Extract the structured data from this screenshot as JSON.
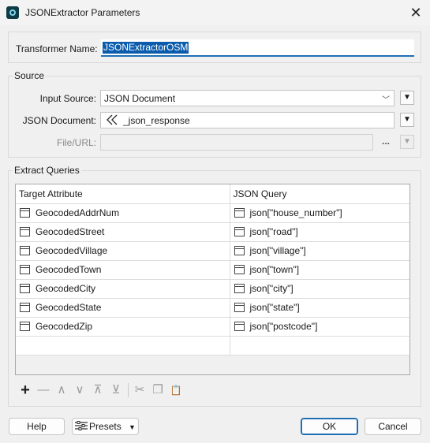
{
  "window": {
    "title": "JSONExtractor Parameters"
  },
  "transformer": {
    "label": "Transformer Name:",
    "value": "JSONExtractorOSM"
  },
  "source": {
    "group_label": "Source",
    "input_source_label": "Input Source:",
    "input_source_value": "JSON Document",
    "json_document_label": "JSON Document:",
    "json_document_value": "_json_response",
    "file_url_label": "File/URL:",
    "file_url_value": "",
    "browse_label": "..."
  },
  "extract": {
    "group_label": "Extract Queries",
    "columns": [
      "Target Attribute",
      "JSON Query"
    ],
    "rows": [
      {
        "attr": "GeocodedAddrNum",
        "query": "json[\"house_number\"]"
      },
      {
        "attr": "GeocodedStreet",
        "query": "json[\"road\"]"
      },
      {
        "attr": "GeocodedVillage",
        "query": "json[\"village\"]"
      },
      {
        "attr": "GeocodedTown",
        "query": "json[\"town\"]"
      },
      {
        "attr": "GeocodedCity",
        "query": "json[\"city\"]"
      },
      {
        "attr": "GeocodedState",
        "query": "json[\"state\"]"
      },
      {
        "attr": "GeocodedZip",
        "query": "json[\"postcode\"]"
      }
    ]
  },
  "toolbar": {
    "add": "+",
    "remove": "—",
    "up": "∧",
    "down": "∨",
    "top": "⊼",
    "bottom": "⊻",
    "cut": "✂",
    "copy": "❐",
    "paste": "📋"
  },
  "buttons": {
    "help": "Help",
    "presets": "Presets",
    "ok": "OK",
    "cancel": "Cancel"
  },
  "icons": {
    "app": "app-icon",
    "close": "close-icon",
    "chevron": "chevron-down-icon",
    "attribute": "attribute-icon",
    "expression": "expression-icon"
  }
}
